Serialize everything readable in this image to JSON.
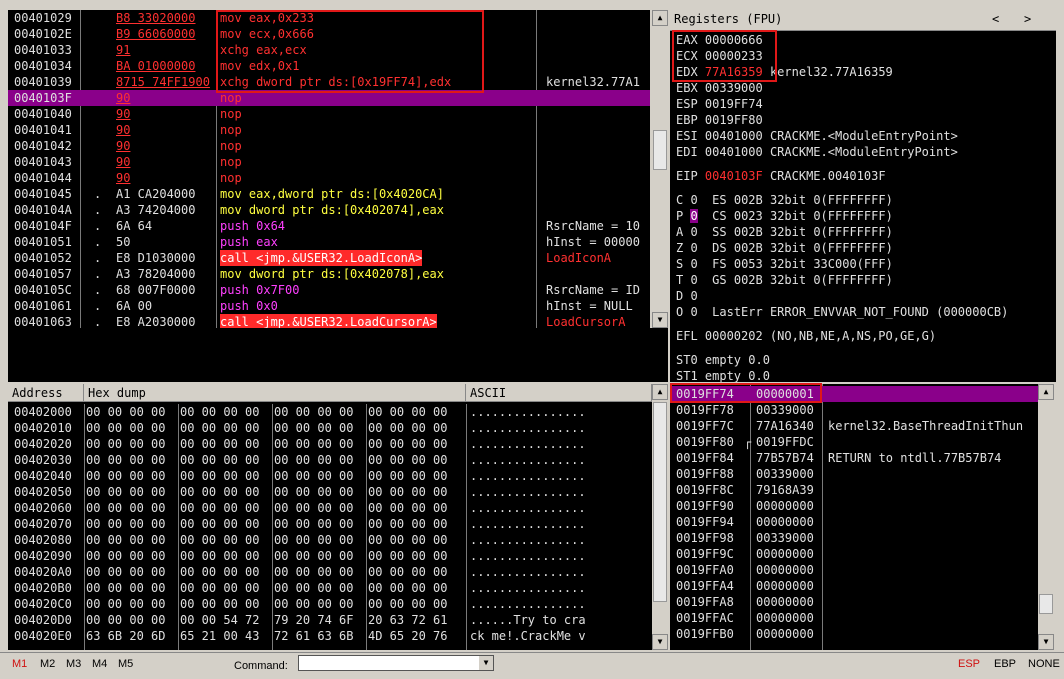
{
  "disasm": {
    "rows": [
      {
        "addr": "00401029",
        "mark": "",
        "bytes": "B8 33020000",
        "instr": "mov eax,0x233",
        "comment": ""
      },
      {
        "addr": "0040102E",
        "mark": "",
        "bytes": "B9 66060000",
        "instr": "mov ecx,0x666",
        "comment": ""
      },
      {
        "addr": "00401033",
        "mark": "",
        "bytes": "91",
        "instr": "xchg eax,ecx",
        "comment": ""
      },
      {
        "addr": "00401034",
        "mark": "",
        "bytes": "BA 01000000",
        "instr": "mov edx,0x1",
        "comment": ""
      },
      {
        "addr": "00401039",
        "mark": "",
        "bytes": "8715 74FF1900",
        "instr": "xchg dword ptr ds:[0x19FF74],edx",
        "comment": "kernel32.77A1"
      },
      {
        "addr": "0040103F",
        "mark": "",
        "bytes": "90",
        "instr": "nop",
        "comment": ""
      },
      {
        "addr": "00401040",
        "mark": "",
        "bytes": "90",
        "instr": "nop",
        "comment": ""
      },
      {
        "addr": "00401041",
        "mark": "",
        "bytes": "90",
        "instr": "nop",
        "comment": ""
      },
      {
        "addr": "00401042",
        "mark": "",
        "bytes": "90",
        "instr": "nop",
        "comment": ""
      },
      {
        "addr": "00401043",
        "mark": "",
        "bytes": "90",
        "instr": "nop",
        "comment": ""
      },
      {
        "addr": "00401044",
        "mark": "",
        "bytes": "90",
        "instr": "nop",
        "comment": ""
      },
      {
        "addr": "00401045",
        "mark": ".",
        "bytes": "A1 CA204000",
        "instr": "mov eax,dword ptr ds:[0x4020CA]",
        "comment": ""
      },
      {
        "addr": "0040104A",
        "mark": ".",
        "bytes": "A3 74204000",
        "instr": "mov dword ptr ds:[0x402074],eax",
        "comment": ""
      },
      {
        "addr": "0040104F",
        "mark": ".",
        "bytes": "6A 64",
        "instr": "push 0x64",
        "comment": "RsrcName = 10"
      },
      {
        "addr": "00401051",
        "mark": ".",
        "bytes": "50",
        "instr": "push eax",
        "comment": "hInst = 00000"
      },
      {
        "addr": "00401052",
        "mark": ".",
        "bytes": "E8 D1030000",
        "instr": "call <jmp.&USER32.LoadIconA>",
        "comment": "LoadIconA"
      },
      {
        "addr": "00401057",
        "mark": ".",
        "bytes": "A3 78204000",
        "instr": "mov dword ptr ds:[0x402078],eax",
        "comment": ""
      },
      {
        "addr": "0040105C",
        "mark": ".",
        "bytes": "68 007F0000",
        "instr": "push 0x7F00",
        "comment": "RsrcName = ID"
      },
      {
        "addr": "00401061",
        "mark": ".",
        "bytes": "6A 00",
        "instr": "push 0x0",
        "comment": "hInst = NULL"
      },
      {
        "addr": "00401063",
        "mark": ".",
        "bytes": "E8 A2030000",
        "instr": "call <jmp.&USER32.LoadCursorA>",
        "comment": "LoadCursorA"
      }
    ]
  },
  "registers": {
    "title": "Registers (FPU)",
    "nav_left": "<",
    "nav_right": ">",
    "gpr": [
      {
        "name": "EAX",
        "value": "00000666",
        "note": ""
      },
      {
        "name": "ECX",
        "value": "00000233",
        "note": ""
      },
      {
        "name": "EDX",
        "value": "77A16359",
        "note": "kernel32.77A16359"
      },
      {
        "name": "EBX",
        "value": "00339000",
        "note": ""
      },
      {
        "name": "ESP",
        "value": "0019FF74",
        "note": ""
      },
      {
        "name": "EBP",
        "value": "0019FF80",
        "note": ""
      },
      {
        "name": "ESI",
        "value": "00401000",
        "note": "CRACKME.<ModuleEntryPoint>"
      },
      {
        "name": "EDI",
        "value": "00401000",
        "note": "CRACKME.<ModuleEntryPoint>"
      }
    ],
    "eip": {
      "name": "EIP",
      "value": "0040103F",
      "note": "CRACKME.0040103F"
    },
    "flags": [
      {
        "f": "C",
        "v": "0",
        "seg": "ES",
        "sel": "002B",
        "desc": "32bit 0(FFFFFFFF)"
      },
      {
        "f": "P",
        "v": "0",
        "seg": "CS",
        "sel": "0023",
        "desc": "32bit 0(FFFFFFFF)"
      },
      {
        "f": "A",
        "v": "0",
        "seg": "SS",
        "sel": "002B",
        "desc": "32bit 0(FFFFFFFF)"
      },
      {
        "f": "Z",
        "v": "0",
        "seg": "DS",
        "sel": "002B",
        "desc": "32bit 0(FFFFFFFF)"
      },
      {
        "f": "S",
        "v": "0",
        "seg": "FS",
        "sel": "0053",
        "desc": "32bit 33C000(FFF)"
      },
      {
        "f": "T",
        "v": "0",
        "seg": "GS",
        "sel": "002B",
        "desc": "32bit 0(FFFFFFFF)"
      },
      {
        "f": "D",
        "v": "0",
        "seg": "",
        "sel": "",
        "desc": ""
      }
    ],
    "lasterr": {
      "f": "O",
      "v": "0",
      "text": "LastErr ERROR_ENVVAR_NOT_FOUND (000000CB)"
    },
    "efl": "EFL 00000202 (NO,NB,NE,A,NS,PO,GE,G)",
    "st0": "ST0 empty 0.0",
    "st1": "ST1 empty 0.0"
  },
  "dump": {
    "col_address": "Address",
    "col_hex": "Hex dump",
    "col_ascii": "ASCII",
    "rows": [
      {
        "addr": "00402000",
        "hex": [
          "00 00 00 00",
          "00 00 00 00",
          "00 00 00 00",
          "00 00 00 00"
        ],
        "ascii": "................"
      },
      {
        "addr": "00402010",
        "hex": [
          "00 00 00 00",
          "00 00 00 00",
          "00 00 00 00",
          "00 00 00 00"
        ],
        "ascii": "................"
      },
      {
        "addr": "00402020",
        "hex": [
          "00 00 00 00",
          "00 00 00 00",
          "00 00 00 00",
          "00 00 00 00"
        ],
        "ascii": "................"
      },
      {
        "addr": "00402030",
        "hex": [
          "00 00 00 00",
          "00 00 00 00",
          "00 00 00 00",
          "00 00 00 00"
        ],
        "ascii": "................"
      },
      {
        "addr": "00402040",
        "hex": [
          "00 00 00 00",
          "00 00 00 00",
          "00 00 00 00",
          "00 00 00 00"
        ],
        "ascii": "................"
      },
      {
        "addr": "00402050",
        "hex": [
          "00 00 00 00",
          "00 00 00 00",
          "00 00 00 00",
          "00 00 00 00"
        ],
        "ascii": "................"
      },
      {
        "addr": "00402060",
        "hex": [
          "00 00 00 00",
          "00 00 00 00",
          "00 00 00 00",
          "00 00 00 00"
        ],
        "ascii": "................"
      },
      {
        "addr": "00402070",
        "hex": [
          "00 00 00 00",
          "00 00 00 00",
          "00 00 00 00",
          "00 00 00 00"
        ],
        "ascii": "................"
      },
      {
        "addr": "00402080",
        "hex": [
          "00 00 00 00",
          "00 00 00 00",
          "00 00 00 00",
          "00 00 00 00"
        ],
        "ascii": "................"
      },
      {
        "addr": "00402090",
        "hex": [
          "00 00 00 00",
          "00 00 00 00",
          "00 00 00 00",
          "00 00 00 00"
        ],
        "ascii": "................"
      },
      {
        "addr": "004020A0",
        "hex": [
          "00 00 00 00",
          "00 00 00 00",
          "00 00 00 00",
          "00 00 00 00"
        ],
        "ascii": "................"
      },
      {
        "addr": "004020B0",
        "hex": [
          "00 00 00 00",
          "00 00 00 00",
          "00 00 00 00",
          "00 00 00 00"
        ],
        "ascii": "................"
      },
      {
        "addr": "004020C0",
        "hex": [
          "00 00 00 00",
          "00 00 00 00",
          "00 00 00 00",
          "00 00 00 00"
        ],
        "ascii": "................"
      },
      {
        "addr": "004020D0",
        "hex": [
          "00 00 00 00",
          "00 00 54 72",
          "79 20 74 6F",
          "20 63 72 61"
        ],
        "ascii": "......Try to cra"
      },
      {
        "addr": "004020E0",
        "hex": [
          "63 6B 20 6D",
          "65 21 00 43",
          "72 61 63 6B",
          "4D 65 20 76"
        ],
        "ascii": "ck me!.CrackMe v"
      }
    ]
  },
  "stack": {
    "rows": [
      {
        "addr": "0019FF74",
        "val": "00000001",
        "note": "",
        "arrow": ""
      },
      {
        "addr": "0019FF78",
        "val": "00339000",
        "note": "",
        "arrow": ""
      },
      {
        "addr": "0019FF7C",
        "val": "77A16340",
        "note": "kernel32.BaseThreadInitThun",
        "arrow": ""
      },
      {
        "addr": "0019FF80",
        "val": "0019FFDC",
        "note": "",
        "arrow": "r"
      },
      {
        "addr": "0019FF84",
        "val": "77B57B74",
        "note": "RETURN to ntdll.77B57B74",
        "arrow": ""
      },
      {
        "addr": "0019FF88",
        "val": "00339000",
        "note": "",
        "arrow": ""
      },
      {
        "addr": "0019FF8C",
        "val": "79168A39",
        "note": "",
        "arrow": ""
      },
      {
        "addr": "0019FF90",
        "val": "00000000",
        "note": "",
        "arrow": ""
      },
      {
        "addr": "0019FF94",
        "val": "00000000",
        "note": "",
        "arrow": ""
      },
      {
        "addr": "0019FF98",
        "val": "00339000",
        "note": "",
        "arrow": ""
      },
      {
        "addr": "0019FF9C",
        "val": "00000000",
        "note": "",
        "arrow": ""
      },
      {
        "addr": "0019FFA0",
        "val": "00000000",
        "note": "",
        "arrow": ""
      },
      {
        "addr": "0019FFA4",
        "val": "00000000",
        "note": "",
        "arrow": ""
      },
      {
        "addr": "0019FFA8",
        "val": "00000000",
        "note": "",
        "arrow": ""
      },
      {
        "addr": "0019FFAC",
        "val": "00000000",
        "note": "",
        "arrow": ""
      },
      {
        "addr": "0019FFB0",
        "val": "00000000",
        "note": "",
        "arrow": ""
      }
    ]
  },
  "statusbar": {
    "tabs": [
      "M1",
      "M2",
      "M3",
      "M4",
      "M5"
    ],
    "command_label": "Command:",
    "command_value": "",
    "right": [
      "ESP",
      "EBP",
      "NONE"
    ]
  },
  "colors": {
    "accent_red": "#e01818",
    "selection": "#8a008a",
    "background": "#000000"
  }
}
